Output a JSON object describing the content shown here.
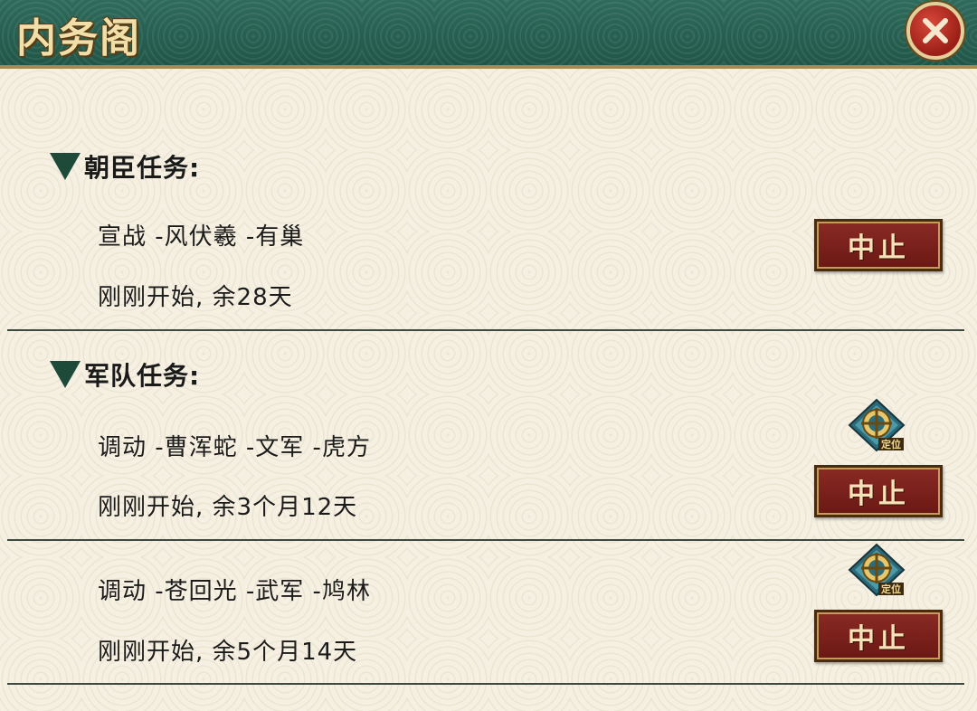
{
  "window": {
    "title": "内务阁",
    "close_icon": "close-x-icon"
  },
  "sections": [
    {
      "title": "朝臣任务:",
      "tasks": [
        {
          "line1": "宣战 -风伏羲 -有巢",
          "line2": "刚刚开始, 余28天",
          "button": "中止"
        }
      ]
    },
    {
      "title": "军队任务:",
      "tasks": [
        {
          "line1": "调动 -曹浑蛇 -文军 -虎方",
          "line2": "刚刚开始, 余3个月12天",
          "button": "中止",
          "locate_icon": "定位",
          "locate_icon_name": "crosshair-locate-icon"
        },
        {
          "line1": "调动 -苍回光 -武军 -鸠林",
          "line2": "刚刚开始, 余5个月14天",
          "button": "中止",
          "locate_icon": "定位",
          "locate_icon_name": "crosshair-locate-icon"
        }
      ]
    }
  ],
  "colors": {
    "header_green": "#2f6b5c",
    "button_red": "#7a2019",
    "title_gold": "#f1dfaa"
  }
}
